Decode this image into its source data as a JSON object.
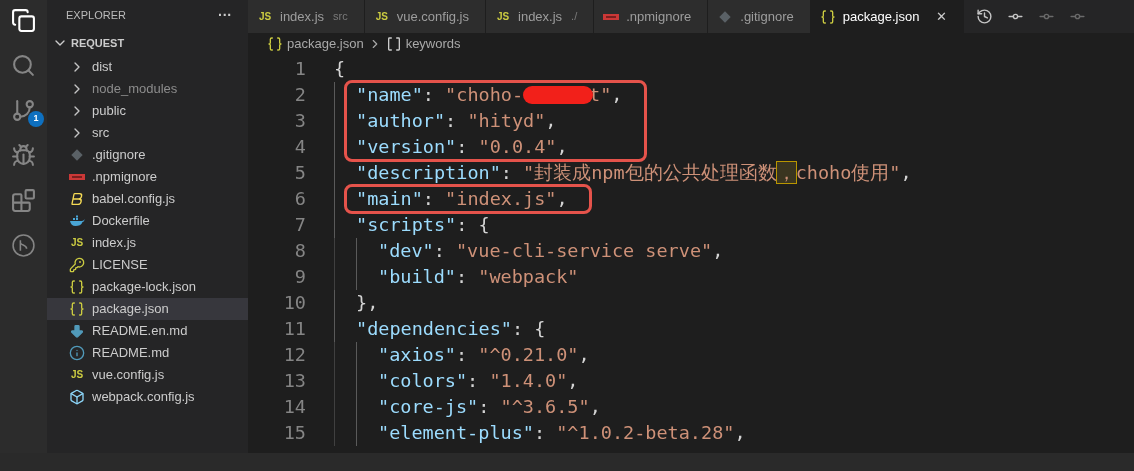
{
  "activity_bar": {
    "items": [
      {
        "kind": "explorer",
        "selected": true
      },
      {
        "kind": "search",
        "selected": false
      },
      {
        "kind": "source-control",
        "selected": false,
        "badge": "1"
      },
      {
        "kind": "run",
        "selected": false
      },
      {
        "kind": "extensions",
        "selected": false
      },
      {
        "kind": "remote",
        "selected": false
      }
    ]
  },
  "explorer": {
    "title": "EXPLORER",
    "more": "···",
    "root": {
      "label": "REQUEST",
      "expanded": true,
      "children": [
        {
          "label": "dist",
          "kind": "folder",
          "expanded": false,
          "dimmed": false,
          "selected": false
        },
        {
          "label": "node_modules",
          "kind": "folder",
          "expanded": false,
          "dimmed": true,
          "selected": false
        },
        {
          "label": "public",
          "kind": "folder",
          "expanded": false,
          "dimmed": false,
          "selected": false
        },
        {
          "label": "src",
          "kind": "folder",
          "expanded": false,
          "dimmed": false,
          "selected": false
        },
        {
          "label": ".gitignore",
          "kind": "git",
          "dimmed": false,
          "selected": false
        },
        {
          "label": ".npmignore",
          "kind": "npm",
          "dimmed": false,
          "selected": false
        },
        {
          "label": "babel.config.js",
          "kind": "babel",
          "dimmed": false,
          "selected": false
        },
        {
          "label": "Dockerfile",
          "kind": "docker",
          "dimmed": false,
          "selected": false
        },
        {
          "label": "index.js",
          "kind": "js",
          "badge": "JS",
          "dimmed": false,
          "selected": false
        },
        {
          "label": "LICENSE",
          "kind": "license",
          "dimmed": false,
          "selected": false
        },
        {
          "label": "package-lock.json",
          "kind": "json",
          "dimmed": false,
          "selected": false
        },
        {
          "label": "package.json",
          "kind": "json",
          "dimmed": false,
          "selected": true
        },
        {
          "label": "README.en.md",
          "kind": "markdown",
          "dimmed": false,
          "selected": false
        },
        {
          "label": "README.md",
          "kind": "info",
          "dimmed": false,
          "selected": false
        },
        {
          "label": "vue.config.js",
          "kind": "js",
          "badge": "JS",
          "dimmed": false,
          "selected": false
        },
        {
          "label": "webpack.config.js",
          "kind": "webpack",
          "dimmed": false,
          "selected": false
        }
      ]
    }
  },
  "tabs": [
    {
      "label": "index.js",
      "description": "src",
      "kind": "js",
      "badge": "JS",
      "selected": false
    },
    {
      "label": "vue.config.js",
      "kind": "js",
      "badge": "JS",
      "selected": false
    },
    {
      "label": "index.js",
      "description": "./",
      "kind": "js",
      "badge": "JS",
      "selected": false
    },
    {
      "label": ".npmignore",
      "kind": "npm",
      "selected": false
    },
    {
      "label": ".gitignore",
      "kind": "git",
      "selected": false
    },
    {
      "label": "package.json",
      "kind": "json",
      "selected": true,
      "close": "✕"
    }
  ],
  "breadcrumb": [
    {
      "label": "package.json",
      "kind": "json"
    },
    {
      "label": "keywords",
      "kind": "array"
    }
  ],
  "code": [
    {
      "number": "1",
      "boxed": false,
      "tokens": [
        {
          "kind": "punct",
          "text": "{"
        }
      ],
      "children": [
        {
          "number": "2",
          "boxed": true,
          "tokens": [
            {
              "kind": "key",
              "text": "\"name\""
            },
            {
              "kind": "punct",
              "text": ": "
            },
            {
              "kind": "string",
              "text": "\"choho-"
            },
            {
              "kind": "redaction"
            },
            {
              "kind": "string",
              "text": "t\""
            },
            {
              "kind": "punct",
              "text": ","
            }
          ]
        },
        {
          "number": "3",
          "boxed": true,
          "tokens": [
            {
              "kind": "key",
              "text": "\"author\""
            },
            {
              "kind": "punct",
              "text": ": "
            },
            {
              "kind": "string",
              "text": "\"hityd\""
            },
            {
              "kind": "punct",
              "text": ","
            }
          ]
        },
        {
          "number": "4",
          "boxed": true,
          "tokens": [
            {
              "kind": "key",
              "text": "\"version\""
            },
            {
              "kind": "punct",
              "text": ": "
            },
            {
              "kind": "string",
              "text": "\"0.0.4\""
            },
            {
              "kind": "punct",
              "text": ","
            }
          ]
        },
        {
          "number": "5",
          "boxed": false,
          "tokens": [
            {
              "kind": "key",
              "text": "\"description\""
            },
            {
              "kind": "punct",
              "text": ": "
            },
            {
              "kind": "string",
              "text": "\"封装成npm包的公共处理函数"
            },
            {
              "kind": "highlight",
              "text": "，"
            },
            {
              "kind": "string",
              "text": "choho使用\""
            },
            {
              "kind": "punct",
              "text": ","
            }
          ]
        },
        {
          "number": "6",
          "boxed": true,
          "tokens": [
            {
              "kind": "key",
              "text": "\"main\""
            },
            {
              "kind": "punct",
              "text": ": "
            },
            {
              "kind": "string",
              "text": "\"index.js\""
            },
            {
              "kind": "punct",
              "text": ","
            }
          ]
        },
        {
          "number": "7",
          "boxed": false,
          "tokens": [
            {
              "kind": "key",
              "text": "\"scripts\""
            },
            {
              "kind": "punct",
              "text": ": {"
            }
          ],
          "children": [
            {
              "number": "8",
              "boxed": false,
              "tokens": [
                {
                  "kind": "key",
                  "text": "\"dev\""
                },
                {
                  "kind": "punct",
                  "text": ": "
                },
                {
                  "kind": "string",
                  "text": "\"vue-cli-service serve\""
                },
                {
                  "kind": "punct",
                  "text": ","
                }
              ]
            },
            {
              "number": "9",
              "boxed": false,
              "tokens": [
                {
                  "kind": "key",
                  "text": "\"build\""
                },
                {
                  "kind": "punct",
                  "text": ": "
                },
                {
                  "kind": "string",
                  "text": "\"webpack\""
                }
              ]
            }
          ]
        },
        {
          "number": "10",
          "boxed": false,
          "tokens": [
            {
              "kind": "punct",
              "text": "},"
            }
          ]
        },
        {
          "number": "11",
          "boxed": false,
          "tokens": [
            {
              "kind": "key",
              "text": "\"dependencies\""
            },
            {
              "kind": "punct",
              "text": ": {"
            }
          ],
          "children": [
            {
              "number": "12",
              "boxed": false,
              "tokens": [
                {
                  "kind": "key",
                  "text": "\"axios\""
                },
                {
                  "kind": "punct",
                  "text": ": "
                },
                {
                  "kind": "string",
                  "text": "\"^0.21.0\""
                },
                {
                  "kind": "punct",
                  "text": ","
                }
              ]
            },
            {
              "number": "13",
              "boxed": false,
              "tokens": [
                {
                  "kind": "key",
                  "text": "\"colors\""
                },
                {
                  "kind": "punct",
                  "text": ": "
                },
                {
                  "kind": "string",
                  "text": "\"1.4.0\""
                },
                {
                  "kind": "punct",
                  "text": ","
                }
              ]
            },
            {
              "number": "14",
              "boxed": false,
              "tokens": [
                {
                  "kind": "key",
                  "text": "\"core-js\""
                },
                {
                  "kind": "punct",
                  "text": ": "
                },
                {
                  "kind": "string",
                  "text": "\"^3.6.5\""
                },
                {
                  "kind": "punct",
                  "text": ","
                }
              ]
            },
            {
              "number": "15",
              "boxed": false,
              "tokens": [
                {
                  "kind": "key",
                  "text": "\"element-plus\""
                },
                {
                  "kind": "punct",
                  "text": ": "
                },
                {
                  "kind": "string",
                  "text": "\"^1.0.2-beta.28\""
                },
                {
                  "kind": "punct",
                  "text": ","
                }
              ]
            }
          ]
        }
      ]
    }
  ]
}
